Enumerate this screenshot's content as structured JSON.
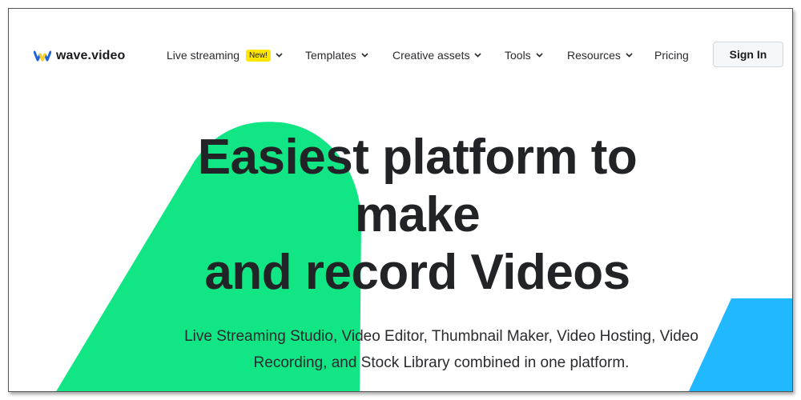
{
  "brand": {
    "name": "wave.video",
    "colors": {
      "logo_blue": "#1f63d8",
      "logo_yellow": "#ffd21f",
      "accent_green": "#12e584",
      "accent_blue": "#21b8ff",
      "badge_yellow": "#ffe600"
    }
  },
  "nav": {
    "items": [
      {
        "label": "Live streaming",
        "badge": "New!",
        "has_dropdown": true
      },
      {
        "label": "Templates",
        "has_dropdown": true
      },
      {
        "label": "Creative assets",
        "has_dropdown": true
      },
      {
        "label": "Tools",
        "has_dropdown": true
      },
      {
        "label": "Resources",
        "has_dropdown": true
      },
      {
        "label": "Pricing",
        "has_dropdown": false
      }
    ],
    "dropdown_icon": "chevron-down-icon"
  },
  "header": {
    "signin_label": "Sign In"
  },
  "hero": {
    "title_lines": [
      "Easiest platform to",
      "make",
      "and record Videos"
    ],
    "subtitle_lines": [
      "Live Streaming Studio, Video Editor, Thumbnail Maker, Video Hosting, Video",
      "Recording, and Stock Library combined in one platform."
    ]
  }
}
